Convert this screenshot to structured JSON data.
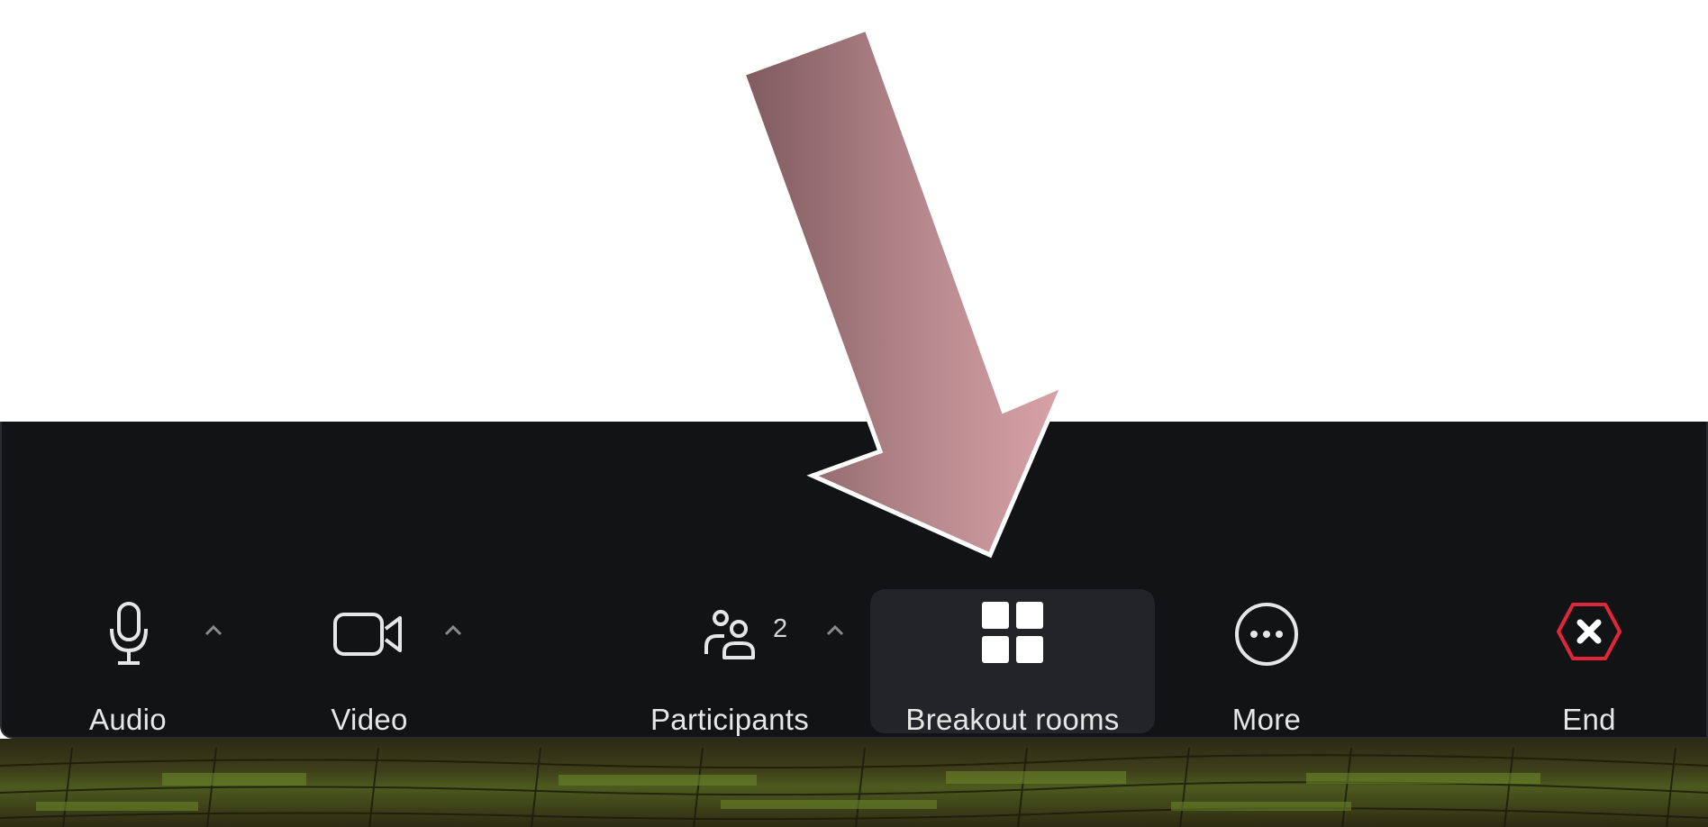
{
  "toolbar": {
    "audio": {
      "label": "Audio",
      "icon": "microphone-icon"
    },
    "video": {
      "label": "Video",
      "icon": "video-camera-icon"
    },
    "participants": {
      "label": "Participants",
      "count": "2",
      "icon": "participants-icon"
    },
    "breakout": {
      "label": "Breakout rooms",
      "icon": "grid-icon"
    },
    "more": {
      "label": "More",
      "icon": "ellipsis-icon"
    },
    "end": {
      "label": "End",
      "icon": "close-hexagon-icon"
    }
  },
  "colors": {
    "toolbar_bg": "#121315",
    "label_text": "#e6e6e6",
    "end_accent": "#e0263a",
    "annotation_arrow": "#b4858a"
  }
}
